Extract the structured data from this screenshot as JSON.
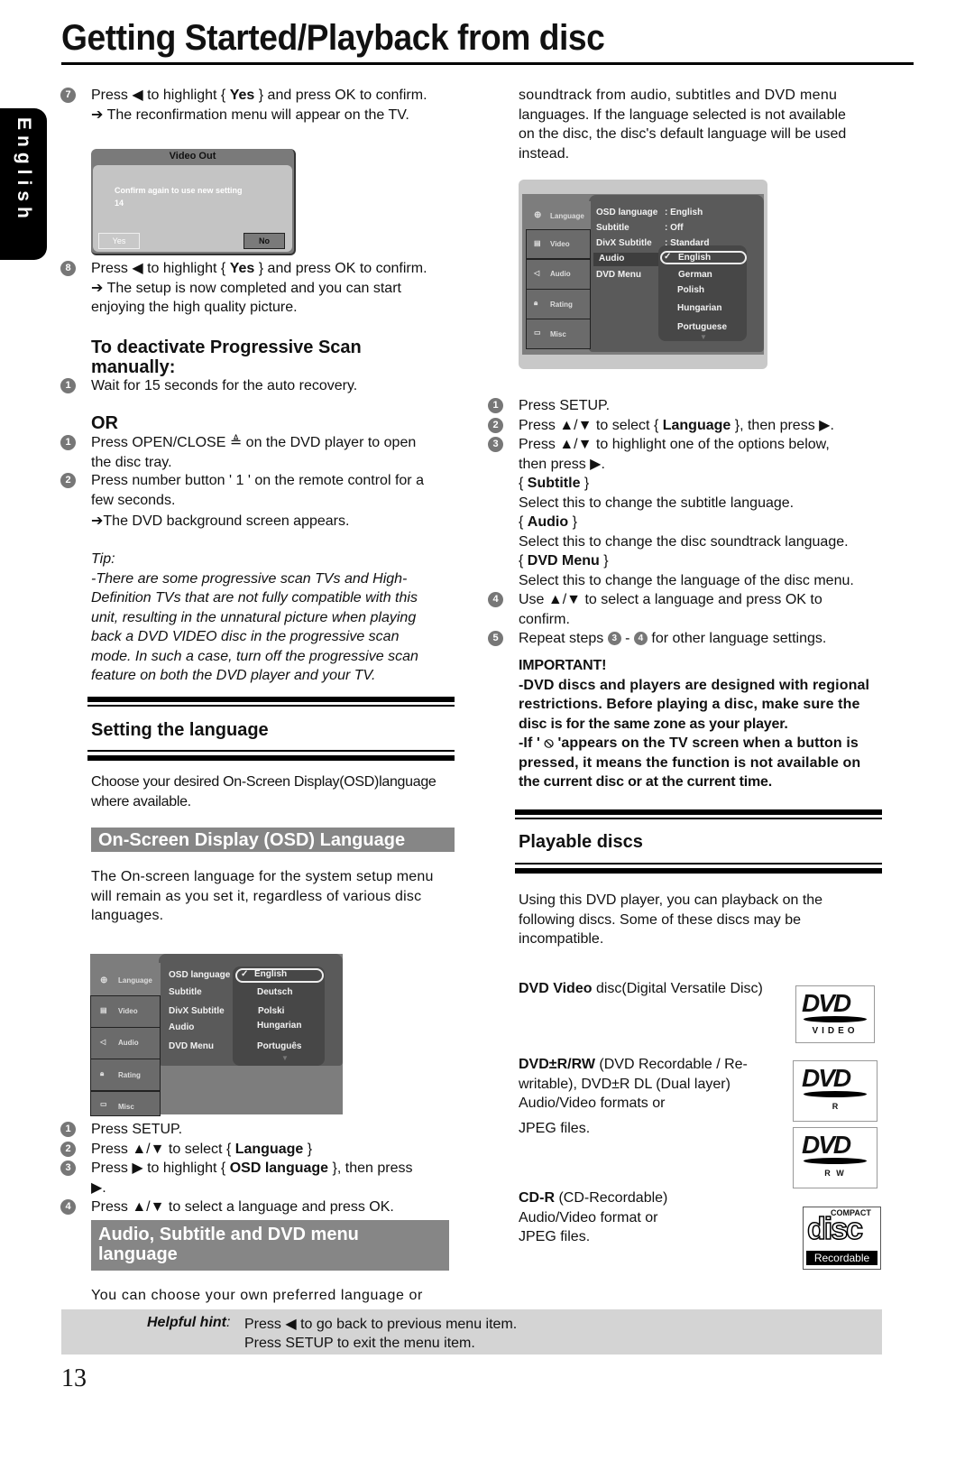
{
  "page": {
    "title": "Getting Started/Playback from disc",
    "side_tab": "English",
    "page_number": "13"
  },
  "left": {
    "step7": {
      "num": "7",
      "pre": "Press ◀ to highlight { ",
      "bold": "Yes",
      "post": " } and press OK to confirm.",
      "arrow": "➔ The reconfirmation menu will appear on the TV."
    },
    "video_out_dialog": {
      "title": "Video Out",
      "message": "Confirm again to use new setting",
      "value": "14",
      "yes": "Yes",
      "no": "No"
    },
    "step8": {
      "num": "8",
      "pre": "Press ◀ to highlight { ",
      "bold": "Yes",
      "post": " } and press OK to confirm.",
      "arrow_line1": "➔ The setup is now completed and you can start",
      "arrow_line2": "enjoying the high quality picture."
    },
    "deactivate_heading_1": "To deactivate Progressive Scan",
    "deactivate_heading_2": "manually:",
    "wait_step": {
      "num": "1",
      "text": "Wait for 15 seconds for the auto recovery."
    },
    "or_label": "OR",
    "or_step1": {
      "num": "1",
      "line1": "Press OPEN/CLOSE ≜  on the DVD player to open",
      "line2": "the disc tray."
    },
    "or_step2": {
      "num": "2",
      "line1": "Press number button ' 1 ' on the remote  control for a",
      "line2": "few seconds."
    },
    "or_arrow": "➔The DVD background screen appears.",
    "tip_label": "Tip:",
    "tip_lines": [
      "-There are some progressive scan TVs and High-",
      "Definition TVs that are not fully compatible with this",
      "unit, resulting in the unnatural picture when playing",
      "back a DVD VIDEO disc in the progressive scan",
      "mode. In such a case, turn off the progressive scan",
      "feature on both the DVD player and your TV."
    ],
    "setting_language_heading": "Setting the language",
    "choose_lines": [
      "Choose your desired On-Screen Display(OSD)language",
      "where available."
    ],
    "osd_heading": "On-Screen Display (OSD) Language",
    "osd_desc_lines": [
      "The On-screen language for the system setup menu",
      "will remain as you set it, regardless of various disc",
      "languages."
    ],
    "osd_menu": {
      "tabs": [
        "Language",
        "Video",
        "Audio",
        "Rating",
        "Misc"
      ],
      "items": [
        "OSD language",
        "Subtitle",
        "DivX Subtitle",
        "Audio",
        "DVD Menu"
      ],
      "options": [
        "English",
        "Deutsch",
        "Polski",
        "Hungarian",
        "Português"
      ],
      "selected": "English"
    },
    "osd_steps": [
      {
        "num": "1",
        "pre": "Press SETUP.",
        "bold": "",
        "post": ""
      },
      {
        "num": "2",
        "pre": "Press ▲/▼ to select { ",
        "bold": "Language",
        "post": " }"
      },
      {
        "num": "3",
        "pre": "Press ▶ to highlight { ",
        "bold": "OSD language",
        "post": " }, then press"
      },
      {
        "num": "4",
        "pre": "Press ▲/▼ to select a language and press OK.",
        "bold": "",
        "post": ""
      }
    ],
    "osd_step3_cont": "▶.",
    "audio_heading_1": "Audio, Subtitle and DVD menu",
    "audio_heading_2": "language",
    "audio_desc": "You can choose your own preferred language or"
  },
  "right": {
    "intro_lines": [
      "soundtrack from audio, subtitles and DVD menu",
      "languages. If the language selected is not available",
      "on the disc, the disc's default language will be used",
      "instead."
    ],
    "audio_menu": {
      "tabs": [
        "Language",
        "Video",
        "Audio",
        "Rating",
        "Misc"
      ],
      "items": [
        "OSD language",
        "Subtitle",
        "DivX Subtitle",
        "Audio",
        "DVD Menu"
      ],
      "values": [
        ": English",
        ": Off",
        ": Standard"
      ],
      "options": [
        "English",
        "German",
        "Polish",
        "Hungarian",
        "Portuguese"
      ],
      "selected": "English"
    },
    "steps": [
      {
        "num": "1",
        "pre": "Press SETUP.",
        "bold": "",
        "post": ""
      },
      {
        "num": "2",
        "pre": "Press ▲/▼ to select { ",
        "bold": "Language",
        "post": " }, then press ▶."
      },
      {
        "num": "3",
        "pre": "Press ▲/▼ to highlight one of the options below,",
        "bold": "",
        "post": ""
      }
    ],
    "step3_cont": "then press ▶.",
    "options_desc": [
      {
        "name": "Subtitle",
        "desc": "Select this to change the subtitle language."
      },
      {
        "name": "Audio",
        "desc": "Select this to change the disc soundtrack language."
      },
      {
        "name": "DVD Menu",
        "desc": "Select this to change the language of the disc menu."
      }
    ],
    "step4": {
      "num": "4",
      "line1": "Use ▲/▼ to select a language and press OK to",
      "line2": "confirm."
    },
    "step5": {
      "num": "5",
      "pre": "Repeat steps ",
      "a": "3",
      "mid": " - ",
      "b": "4",
      "post": " for other language settings."
    },
    "important_label": "IMPORTANT!",
    "important_lines": [
      "-DVD discs and players are designed with regional",
      "restrictions.  Before playing a disc, make sure the",
      "disc is for the same zone as your player.",
      "-If ' ⦸ 'appears on the TV screen when a button is",
      "pressed, it means the function is not available on",
      "the current disc or at the current time."
    ],
    "playable_heading": "Playable discs",
    "playable_desc": [
      "Using this DVD player, you can playback on the",
      "following discs. Some of these discs may be",
      "incompatible."
    ],
    "discs": [
      {
        "bold": "DVD Video",
        "rest": " disc(Digital Versatile Disc)",
        "lines": [],
        "logo_label": "VIDEO"
      },
      {
        "bold": "DVD±R/RW",
        "rest": " (DVD Recordable / Re-",
        "lines": [
          "writable), DVD±R DL (Dual layer)",
          "Audio/Video formats or",
          "JPEG files."
        ],
        "logo_label": "R"
      },
      {
        "bold": "",
        "rest": "",
        "lines": [],
        "logo_label": "R W"
      },
      {
        "bold": "CD-R",
        "rest": " (CD-Recordable)",
        "lines": [
          "Audio/Video format or",
          "JPEG files."
        ],
        "logo_label": "Recordable"
      }
    ],
    "dvd_logo_text": "DVD",
    "cd_logo_top": "COMPACT",
    "cd_logo_mid": "disc"
  },
  "hint": {
    "label": "Helpful hint",
    "colon": ":",
    "line1": "Press ◀ to go back to previous menu item.",
    "line2": "Press SETUP to exit the menu item."
  }
}
